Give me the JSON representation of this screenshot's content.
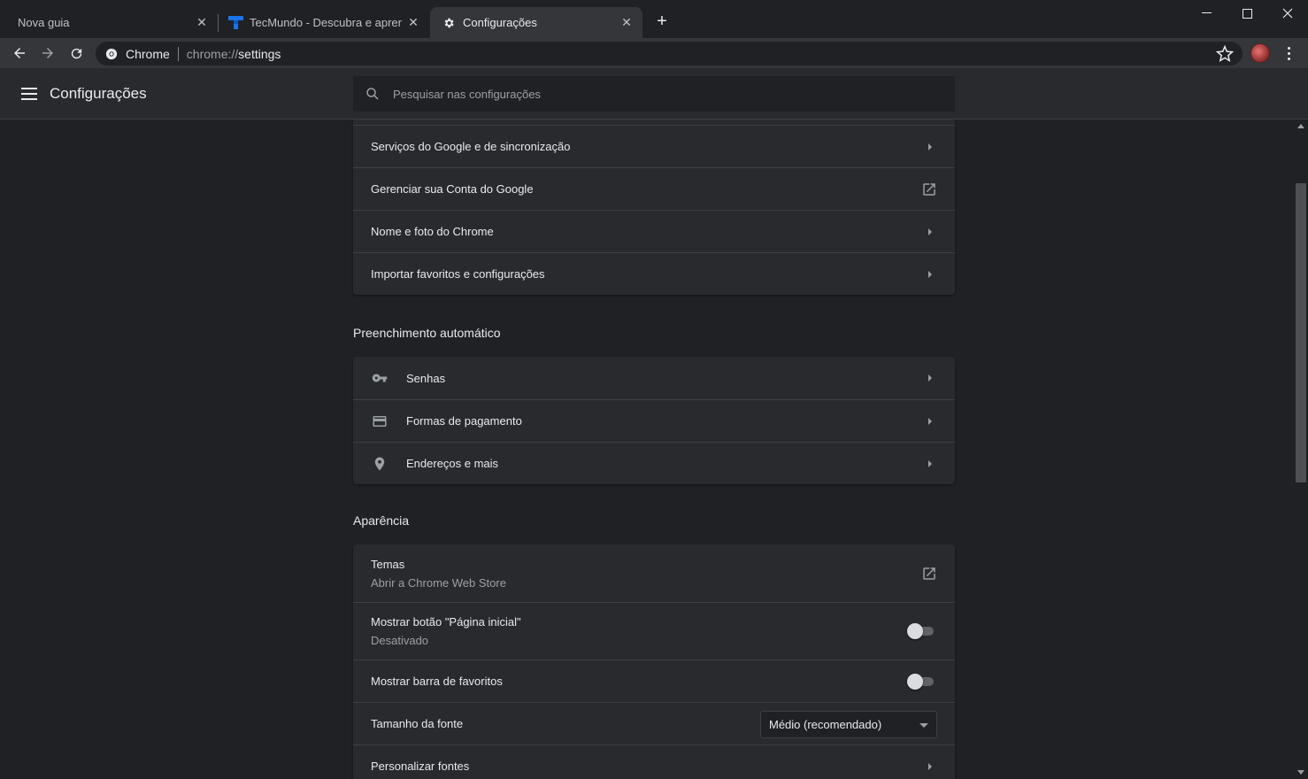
{
  "tabs": [
    {
      "label": "Nova guia",
      "icon": "none"
    },
    {
      "label": "TecMundo - Descubra e aprenda",
      "icon": "tecmundo-favicon"
    },
    {
      "label": "Configurações",
      "icon": "gear-icon",
      "active": true
    }
  ],
  "toolbar": {
    "omnibox_chip": "Chrome",
    "url_scheme": "chrome://",
    "url_host": "settings"
  },
  "header": {
    "title": "Configurações",
    "search_placeholder": "Pesquisar nas configurações"
  },
  "people_card": {
    "items": [
      {
        "label": "Serviços do Google e de sincronização",
        "trailing": "arrow"
      },
      {
        "label": "Gerenciar sua Conta do Google",
        "trailing": "external-link"
      },
      {
        "label": "Nome e foto do Chrome",
        "trailing": "arrow"
      },
      {
        "label": "Importar favoritos e configurações",
        "trailing": "arrow"
      }
    ]
  },
  "autofill": {
    "title": "Preenchimento automático",
    "items": [
      {
        "label": "Senhas",
        "icon": "key-icon"
      },
      {
        "label": "Formas de pagamento",
        "icon": "credit-card-icon"
      },
      {
        "label": "Endereços e mais",
        "icon": "location-pin-icon"
      }
    ]
  },
  "appearance": {
    "title": "Aparência",
    "themes": {
      "label": "Temas",
      "sublabel": "Abrir a Chrome Web Store"
    },
    "home_button": {
      "label": "Mostrar botão \"Página inicial\"",
      "sublabel": "Desativado",
      "enabled": false
    },
    "bookmarks_bar": {
      "label": "Mostrar barra de favoritos",
      "enabled": false
    },
    "font_size": {
      "label": "Tamanho da fonte",
      "value": "Médio (recomendado)"
    },
    "custom_fonts": {
      "label": "Personalizar fontes"
    }
  },
  "colors": {
    "background": "#202124",
    "card": "#292a2d",
    "toolbar": "#35363a",
    "accent": "#8ab4f8"
  }
}
